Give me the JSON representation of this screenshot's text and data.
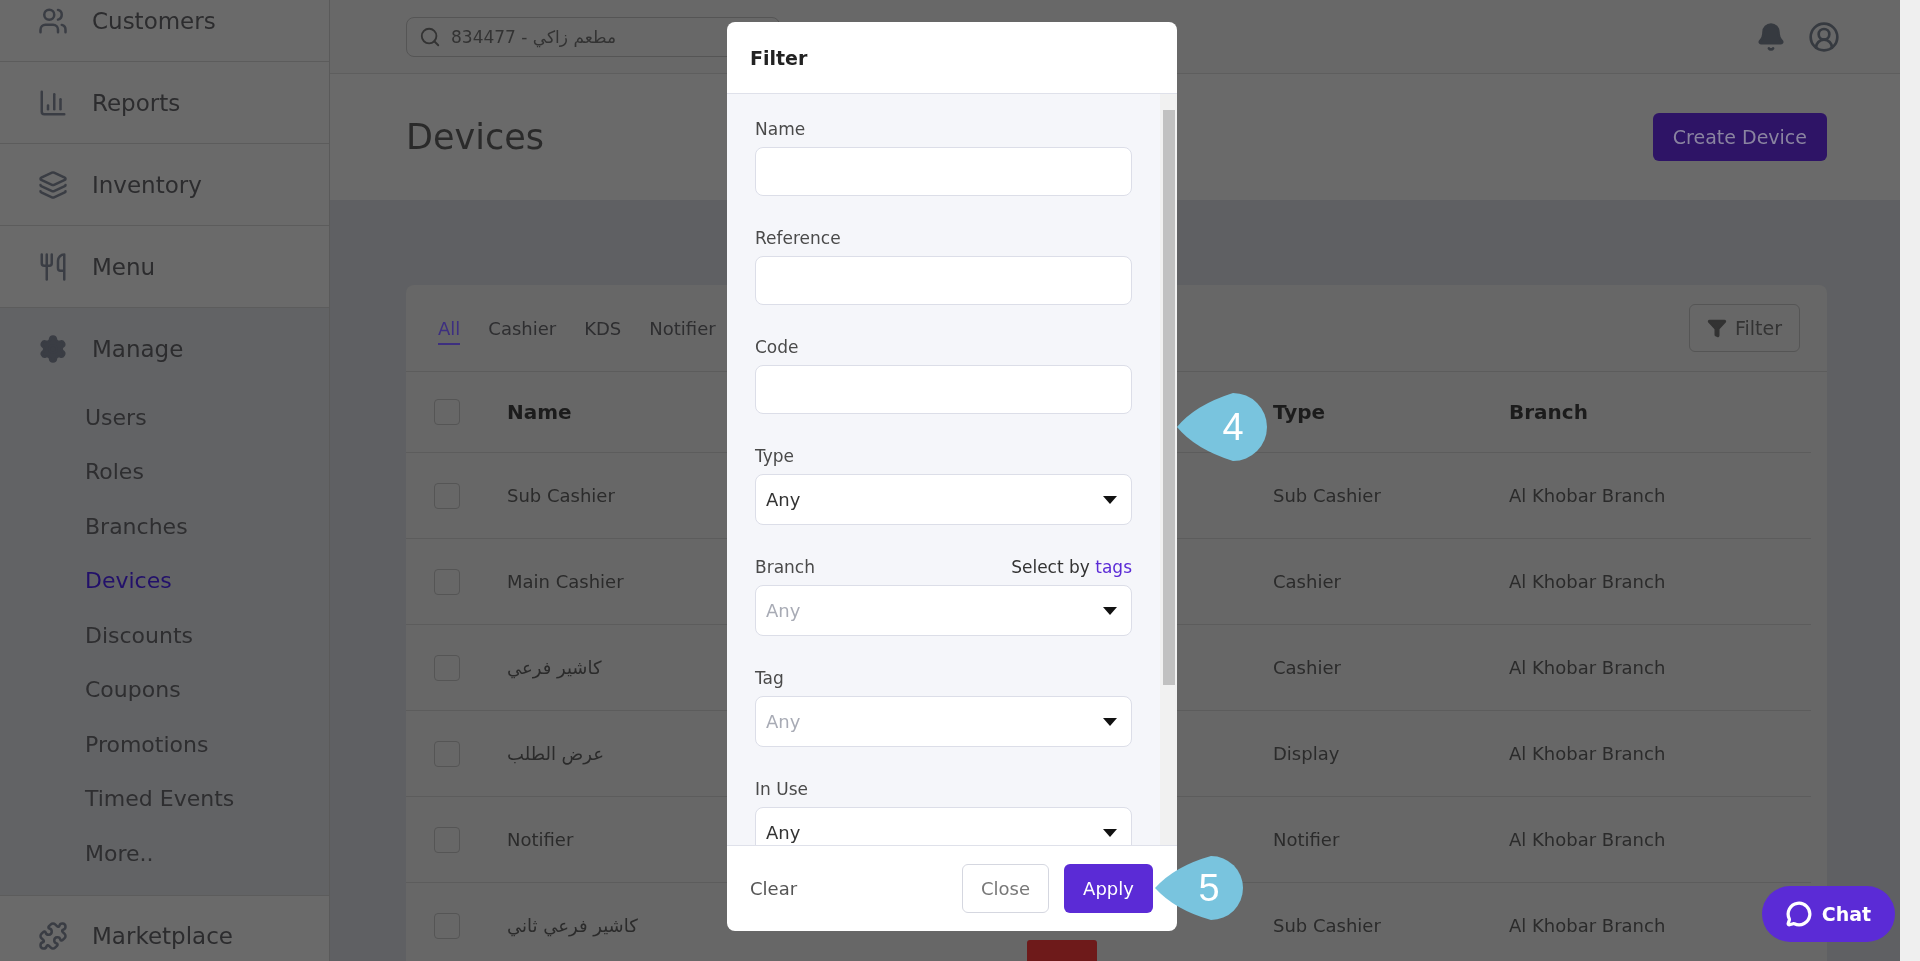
{
  "sidebar": {
    "items": [
      {
        "label": "Customers"
      },
      {
        "label": "Reports"
      },
      {
        "label": "Inventory"
      },
      {
        "label": "Menu"
      },
      {
        "label": "Manage",
        "children": [
          {
            "label": "Users",
            "selected": false
          },
          {
            "label": "Roles",
            "selected": false
          },
          {
            "label": "Branches",
            "selected": false
          },
          {
            "label": "Devices",
            "selected": true
          },
          {
            "label": "Discounts",
            "selected": false
          },
          {
            "label": "Coupons",
            "selected": false
          },
          {
            "label": "Promotions",
            "selected": false
          },
          {
            "label": "Timed Events",
            "selected": false
          },
          {
            "label": "More..",
            "selected": false
          }
        ]
      },
      {
        "label": "Marketplace"
      }
    ]
  },
  "topbar": {
    "search": {
      "placeholder": "834477 - مطعم زاكي"
    }
  },
  "page": {
    "title": "Devices",
    "create_button": "Create Device"
  },
  "tabs": [
    {
      "label": "All",
      "selected": true
    },
    {
      "label": "Cashier",
      "selected": false
    },
    {
      "label": "KDS",
      "selected": false
    },
    {
      "label": "Notifier",
      "selected": false
    }
  ],
  "filter_button": "Filter",
  "table": {
    "all_checked": false,
    "columns": [
      "Name",
      "Type",
      "Branch"
    ],
    "rows": [
      {
        "checked": false,
        "name": "Sub Cashier",
        "type": "Sub Cashier",
        "branch": "Al Khobar Branch"
      },
      {
        "checked": false,
        "name": "Main Cashier",
        "type": "Cashier",
        "branch": "Al Khobar Branch"
      },
      {
        "checked": false,
        "name": "كاشير فرعي",
        "type": "Cashier",
        "branch": "Al Khobar Branch"
      },
      {
        "checked": false,
        "name": "عرض الطلب",
        "type": "Display",
        "branch": "Al Khobar Branch"
      },
      {
        "checked": false,
        "name": "Notifier",
        "type": "Notifier",
        "branch": "Al Khobar Branch"
      },
      {
        "checked": false,
        "name": "كاشير فرعي ثاني",
        "type": "Sub Cashier",
        "branch": "Al Khobar Branch"
      }
    ]
  },
  "modal": {
    "title": "Filter",
    "fields": [
      {
        "kind": "text",
        "label": "Name"
      },
      {
        "kind": "text",
        "label": "Reference"
      },
      {
        "kind": "text",
        "label": "Code"
      },
      {
        "kind": "select",
        "label": "Type",
        "value": "Any"
      },
      {
        "kind": "select",
        "label": "Branch",
        "placeholder": "Any",
        "hint": "Select by ",
        "link": "tags"
      },
      {
        "kind": "select",
        "label": "Tag",
        "placeholder": "Any"
      },
      {
        "kind": "select",
        "label": "In Use",
        "value": "Any"
      }
    ],
    "clear": "Clear",
    "close": "Close",
    "apply": "Apply"
  },
  "callouts": [
    {
      "label": "4"
    },
    {
      "label": "5"
    }
  ],
  "chat": "Chat"
}
